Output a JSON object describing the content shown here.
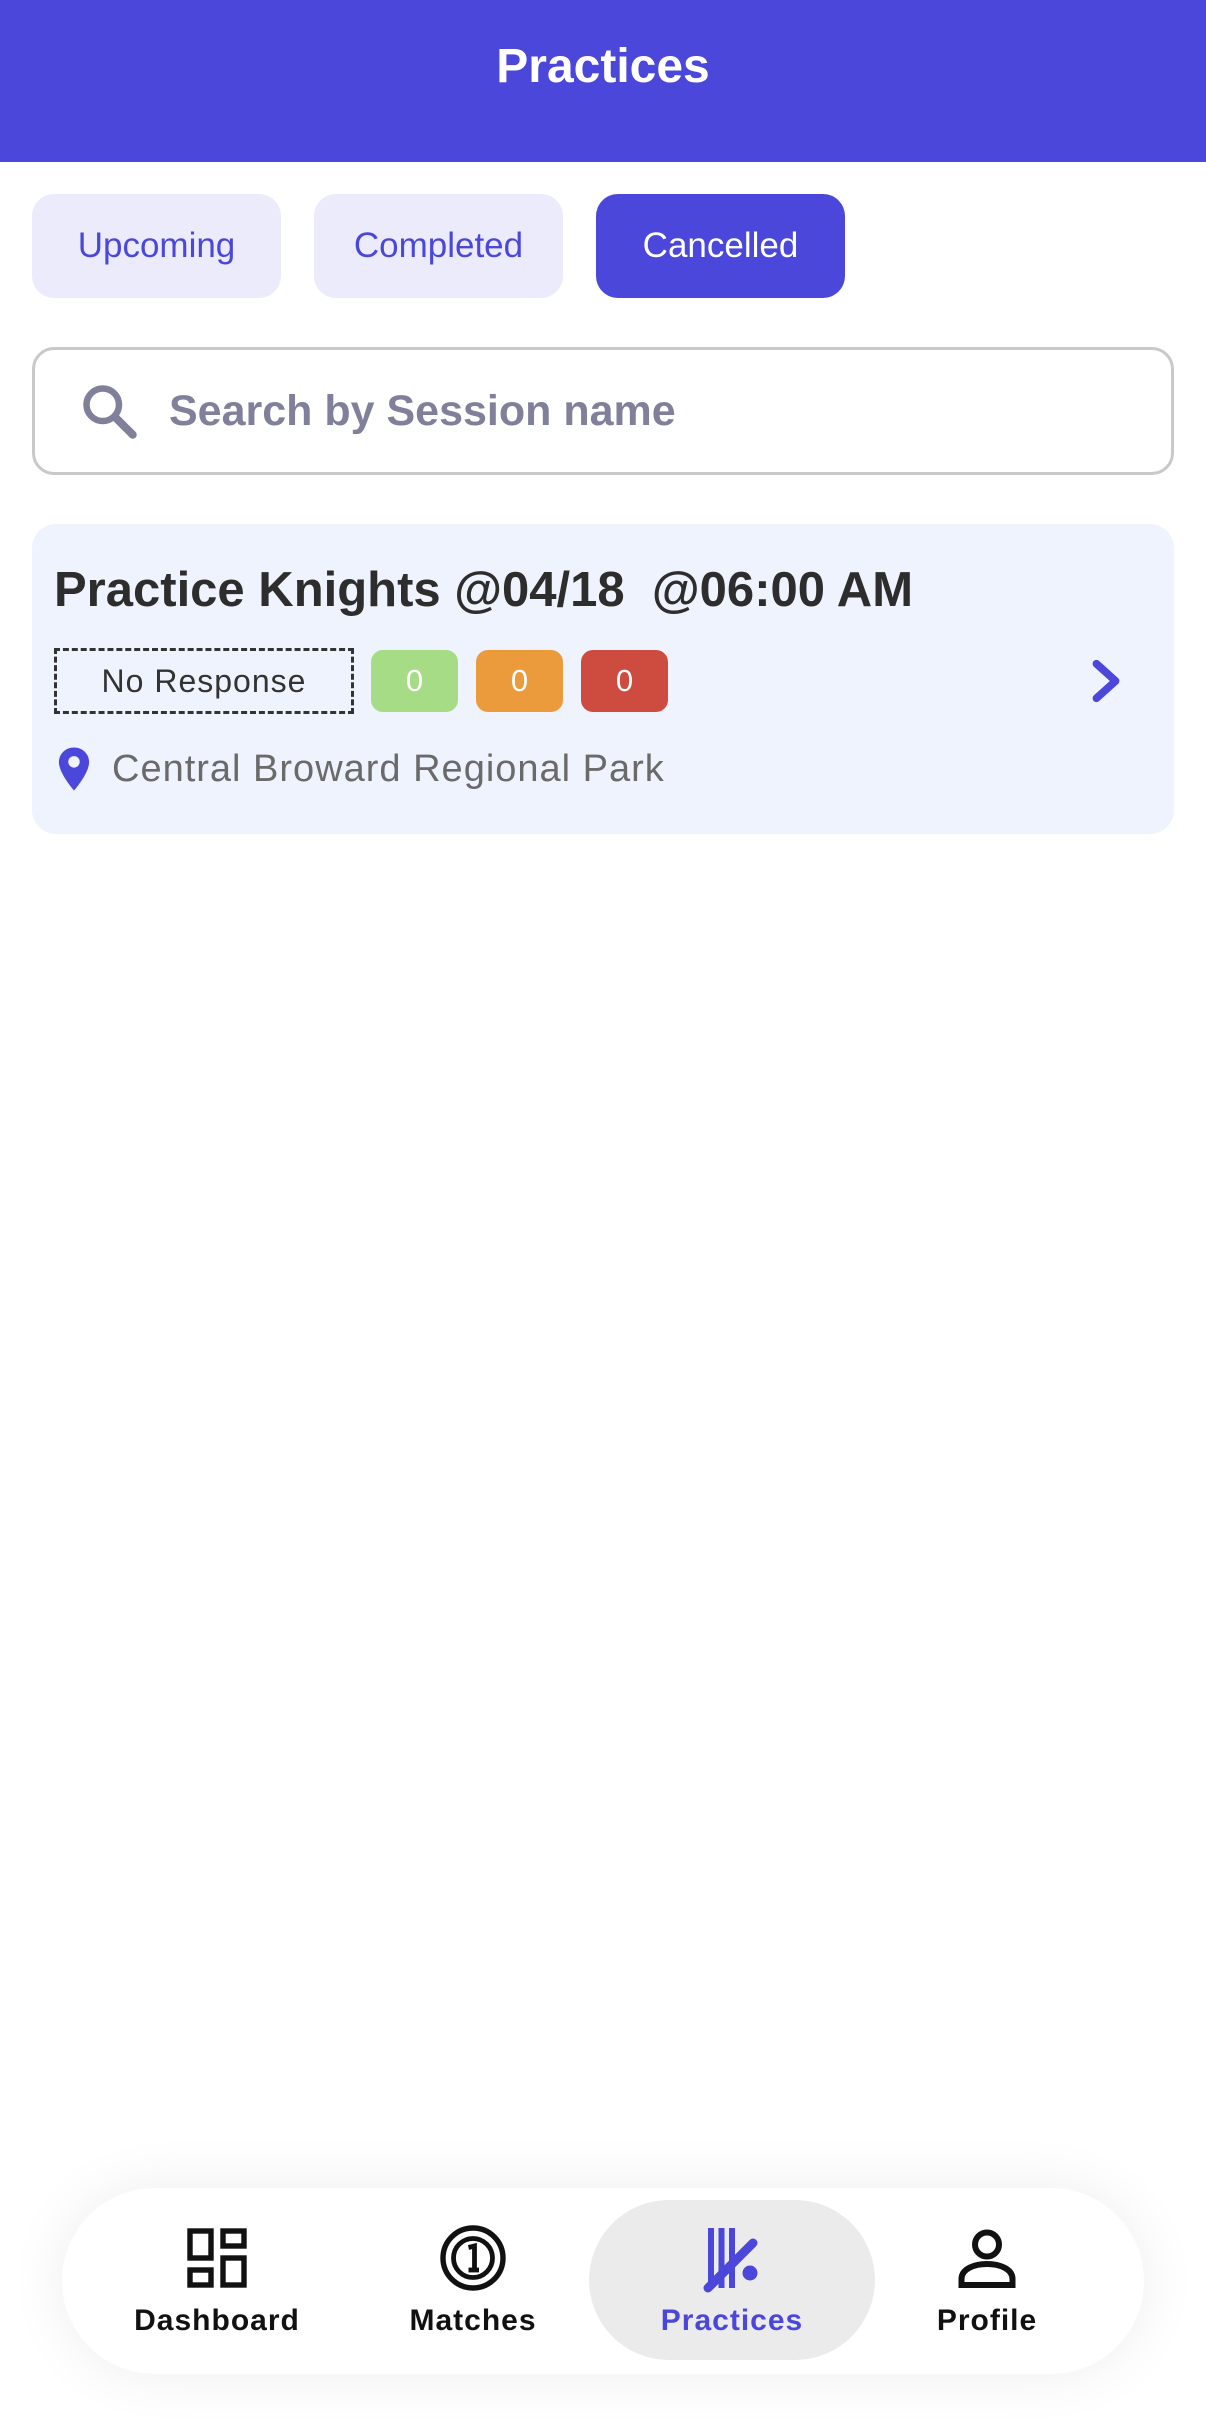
{
  "header": {
    "title": "Practices"
  },
  "tabs": [
    {
      "label": "Upcoming",
      "active": false
    },
    {
      "label": "Completed",
      "active": false
    },
    {
      "label": "Cancelled",
      "active": true
    }
  ],
  "search": {
    "placeholder": "Search by Session name",
    "value": ""
  },
  "sessions": [
    {
      "title": "Practice Knights @04/18  @06:00 AM",
      "response_badge": "No Response",
      "counts": {
        "green": "0",
        "orange": "0",
        "red": "0"
      },
      "location": "Central Broward Regional Park"
    }
  ],
  "bottom_nav": [
    {
      "label": "Dashboard",
      "icon": "dashboard-icon",
      "active": false
    },
    {
      "label": "Matches",
      "icon": "matches-icon",
      "active": false
    },
    {
      "label": "Practices",
      "icon": "practices-icon",
      "active": true
    },
    {
      "label": "Profile",
      "icon": "profile-icon",
      "active": false
    }
  ],
  "colors": {
    "accent": "#4b47db",
    "tab_inactive_bg": "#ebebfb",
    "card_bg": "#eef3fd",
    "count_green": "#a6dc86",
    "count_orange": "#eb9a3c",
    "count_red": "#cd4c3f"
  }
}
